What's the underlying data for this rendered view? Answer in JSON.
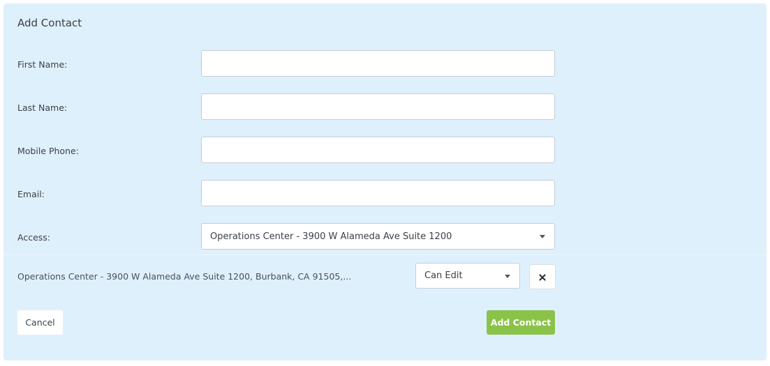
{
  "form": {
    "title": "Add Contact",
    "first_name": {
      "label": "First Name:",
      "value": ""
    },
    "last_name": {
      "label": "Last Name:",
      "value": ""
    },
    "mobile_phone": {
      "label": "Mobile Phone:",
      "value": ""
    },
    "email": {
      "label": "Email:",
      "value": ""
    },
    "access": {
      "label": "Access:",
      "selected": "Operations Center - 3900 W Alameda Ave Suite 1200"
    }
  },
  "access_list": [
    {
      "location": "Operations Center - 3900 W Alameda Ave Suite 1200, Burbank, CA 91505,...",
      "permission": "Can Edit",
      "remove_icon": "close-icon"
    }
  ],
  "buttons": {
    "cancel": "Cancel",
    "add_contact": "Add Contact"
  },
  "colors": {
    "panel_background": "#dff0fd",
    "primary_button": "#8bc34a"
  }
}
